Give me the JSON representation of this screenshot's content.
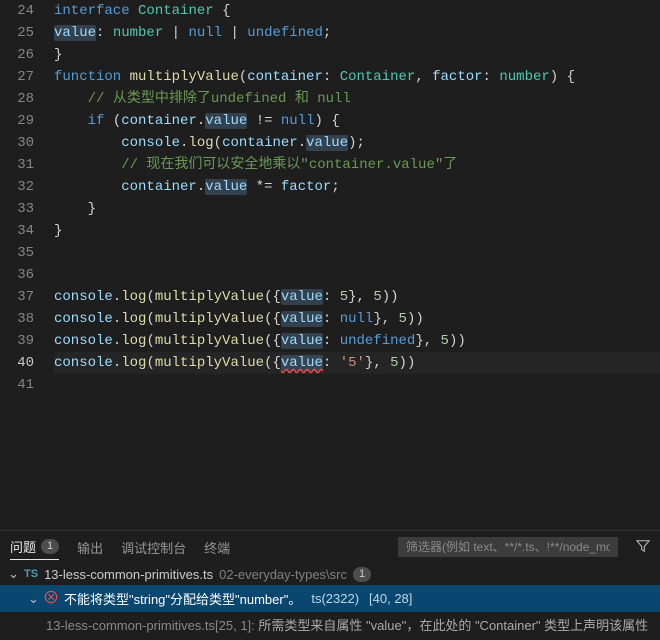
{
  "lines": {
    "start": 24,
    "current": 40,
    "count": 18
  },
  "code": {
    "l24": {
      "kw_interface": "interface",
      "type": "Container",
      "brace": "{"
    },
    "l25": {
      "id": "value",
      "colon": ":",
      "t_number": "number",
      "bar1": "|",
      "t_null": "null",
      "bar2": "|",
      "t_undef": "undefined",
      "semi": ";"
    },
    "l26": {
      "brace": "}"
    },
    "l27": {
      "kw_fn": "function",
      "fn": "multiplyValue",
      "open": "(",
      "p1": "container",
      "c1": ":",
      "t1": "Container",
      "comma": ",",
      "p2": "factor",
      "c2": ":",
      "t2": "number",
      "close": ")",
      "brace": "{"
    },
    "l28": {
      "comment": "// 从类型中排除了undefined 和 null"
    },
    "l29": {
      "kw_if": "if",
      "open": "(",
      "obj": "container",
      "dot": ".",
      "prop": "value",
      "neq": "!=",
      "null": "null",
      "close": ")",
      "brace": "{"
    },
    "l30": {
      "console": "console",
      "dot1": ".",
      "log": "log",
      "open": "(",
      "obj": "container",
      "dot2": ".",
      "prop": "value",
      "close": ");"
    },
    "l31": {
      "comment": "// 现在我们可以安全地乘以\"container.value\"了"
    },
    "l32": {
      "obj": "container",
      "dot": ".",
      "prop": "value",
      "op": "*=",
      "id": "factor",
      "semi": ";"
    },
    "l33": {
      "brace": "}"
    },
    "l34": {
      "brace": "}"
    },
    "l37": {
      "console": "console",
      "dot1": ".",
      "log": "log",
      "open": "(",
      "fn": "multiplyValue",
      "open2": "({",
      "key": "value",
      "colon": ":",
      "val": "5",
      "close2": "},",
      "arg2": "5",
      "close": "))"
    },
    "l38": {
      "console": "console",
      "dot1": ".",
      "log": "log",
      "open": "(",
      "fn": "multiplyValue",
      "open2": "({",
      "key": "value",
      "colon": ":",
      "val": "null",
      "close2": "},",
      "arg2": "5",
      "close": "))"
    },
    "l39": {
      "console": "console",
      "dot1": ".",
      "log": "log",
      "open": "(",
      "fn": "multiplyValue",
      "open2": "({",
      "key": "value",
      "colon": ":",
      "val": "undefined",
      "close2": "},",
      "arg2": "5",
      "close": "))"
    },
    "l40": {
      "console": "console",
      "dot1": ".",
      "log": "log",
      "open": "(",
      "fn": "multiplyValue",
      "open2": "({",
      "key": "value",
      "colon": ":",
      "val": "'5'",
      "close2": "},",
      "arg2": "5",
      "close": "))"
    }
  },
  "panel": {
    "tabs": {
      "problems": "问题",
      "output": "输出",
      "debug": "调试控制台",
      "terminal": "终端"
    },
    "problemsCount": "1",
    "filterPlaceholder": "筛选器(例如 text、**/*.ts、!**/node_modules/**)",
    "file": {
      "name": "13-less-common-primitives.ts",
      "path": "02-everyday-types\\src",
      "count": "1"
    },
    "item": {
      "msg": "不能将类型\"string\"分配给类型\"number\"。",
      "code": "ts(2322)",
      "loc": "[40, 28]"
    },
    "related": {
      "file": "13-less-common-primitives.ts[25, 1]:",
      "msg": "所需类型来自属性 \"value\"，在此处的 \"Container\" 类型上声明该属性"
    }
  }
}
